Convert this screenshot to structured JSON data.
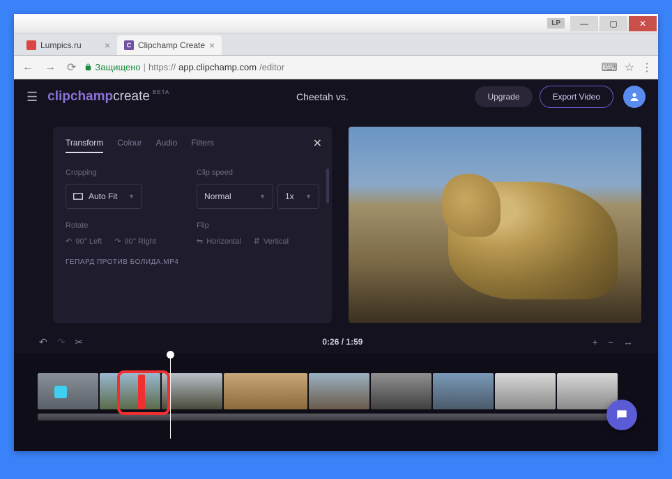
{
  "window": {
    "lp": "LP"
  },
  "tabs": [
    {
      "label": "Lumpics.ru"
    },
    {
      "label": "Clipchamp Create"
    }
  ],
  "address": {
    "secure": "Защищено",
    "host": "https://",
    "domain": "app.clipchamp.com",
    "path": "/editor"
  },
  "logo": {
    "a": "clipchamp",
    "b": "create",
    "beta": "BETA"
  },
  "header": {
    "project": "Cheetah vs.",
    "upgrade": "Upgrade",
    "export": "Export Video"
  },
  "panel": {
    "tabs": {
      "transform": "Transform",
      "colour": "Colour",
      "audio": "Audio",
      "filters": "Filters"
    },
    "cropping": {
      "label": "Cropping",
      "value": "Auto Fit"
    },
    "clipspeed": {
      "label": "Clip speed",
      "value": "Normal",
      "mult": "1x"
    },
    "rotate": {
      "label": "Rotate",
      "left": "90° Left",
      "right": "90° Right"
    },
    "flip": {
      "label": "Flip",
      "h": "Horizontal",
      "v": "Vertical"
    },
    "filename": "ГЕПАРД ПРОТИВ БОЛИДА.MP4"
  },
  "toolbar": {
    "time": "0:26 / 1:59"
  }
}
